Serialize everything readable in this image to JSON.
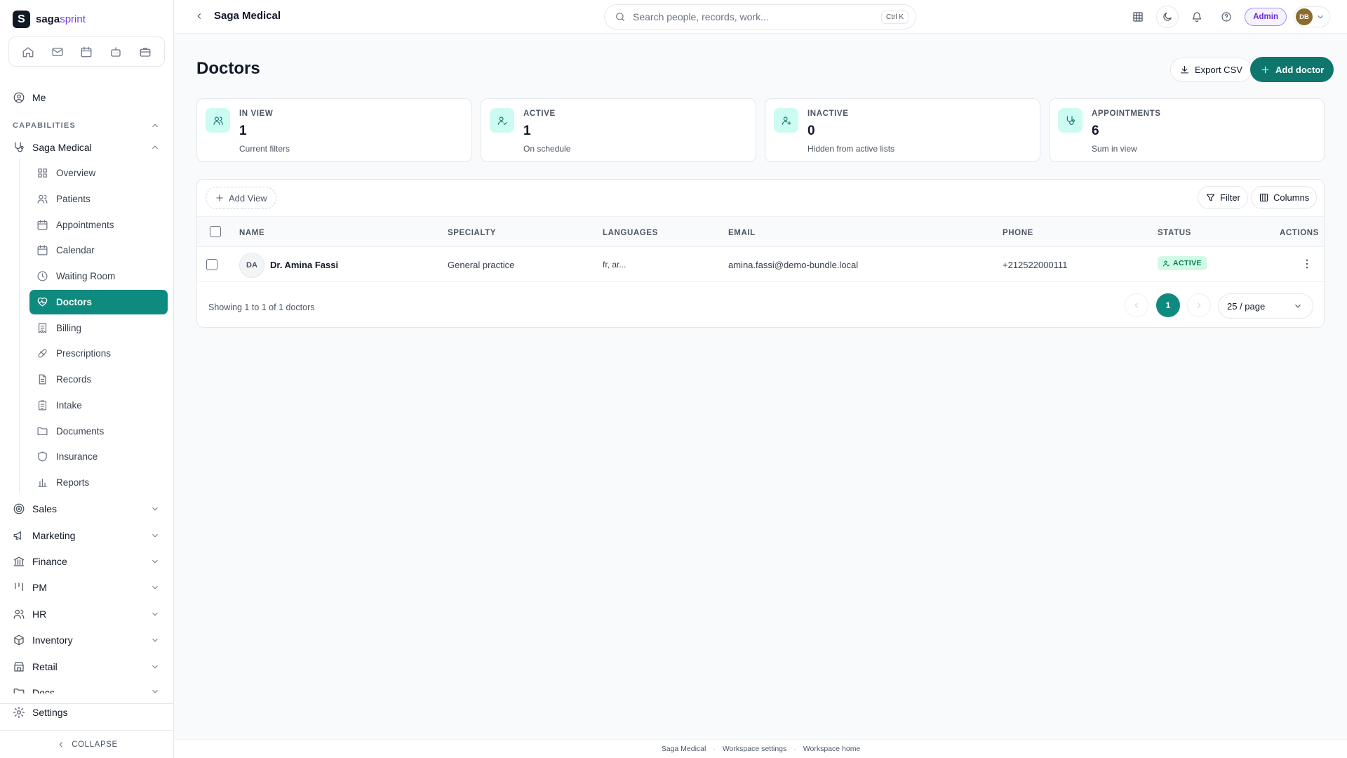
{
  "brand": {
    "name_part1": "saga",
    "name_part2": "sprint",
    "logo_letter": "S"
  },
  "quickbar": [
    "home-icon",
    "mail-icon",
    "calendar-icon",
    "bot-icon",
    "briefcase-icon"
  ],
  "sidebar": {
    "me": "Me",
    "capabilities_label": "CAPABILITIES",
    "active_group": "Saga Medical",
    "sub_items": [
      {
        "label": "Overview",
        "icon": "grid-icon"
      },
      {
        "label": "Patients",
        "icon": "users-icon"
      },
      {
        "label": "Appointments",
        "icon": "calendar-icon"
      },
      {
        "label": "Calendar",
        "icon": "calendar-icon"
      },
      {
        "label": "Waiting Room",
        "icon": "clock-icon"
      },
      {
        "label": "Doctors",
        "icon": "heart-pulse-icon"
      },
      {
        "label": "Billing",
        "icon": "receipt-icon"
      },
      {
        "label": "Prescriptions",
        "icon": "pill-icon"
      },
      {
        "label": "Records",
        "icon": "file-icon"
      },
      {
        "label": "Intake",
        "icon": "clipboard-icon"
      },
      {
        "label": "Documents",
        "icon": "folder-icon"
      },
      {
        "label": "Insurance",
        "icon": "shield-icon"
      },
      {
        "label": "Reports",
        "icon": "bar-chart-icon"
      }
    ],
    "groups": [
      "Sales",
      "Marketing",
      "Finance",
      "PM",
      "HR",
      "Inventory",
      "Retail",
      "Docs"
    ],
    "settings": "Settings",
    "collapse": "COLLAPSE"
  },
  "topbar": {
    "breadcrumb": "Saga Medical",
    "search_placeholder": "Search people, records, work...",
    "search_shortcut": "Ctrl K",
    "role_badge": "Admin",
    "avatar_initials": "DB"
  },
  "page": {
    "title": "Doctors",
    "export_label": "Export CSV",
    "add_label": "Add doctor"
  },
  "stats": [
    {
      "label": "IN VIEW",
      "value": "1",
      "sub": "Current filters",
      "icon": "users-icon"
    },
    {
      "label": "ACTIVE",
      "value": "1",
      "sub": "On schedule",
      "icon": "user-check-icon"
    },
    {
      "label": "INACTIVE",
      "value": "0",
      "sub": "Hidden from active lists",
      "icon": "user-plus-icon"
    },
    {
      "label": "APPOINTMENTS",
      "value": "6",
      "sub": "Sum in view",
      "icon": "stethoscope-icon"
    }
  ],
  "table": {
    "add_view": "Add View",
    "filter": "Filter",
    "columns_btn": "Columns",
    "columns": [
      "NAME",
      "SPECIALTY",
      "LANGUAGES",
      "EMAIL",
      "PHONE",
      "STATUS",
      "ACTIONS"
    ],
    "rows": [
      {
        "initials": "DA",
        "name": "Dr. Amina Fassi",
        "specialty": "General practice",
        "languages": "fr, ar...",
        "email": "amina.fassi@demo-bundle.local",
        "phone": "+212522000111",
        "status": "ACTIVE"
      }
    ],
    "showing": "Showing 1 to 1 of 1 doctors",
    "current_page": "1",
    "per_page": "25 / page"
  },
  "footer": [
    "Saga Medical",
    "Workspace settings",
    "Workspace home"
  ],
  "colors": {
    "accent": "#0f8a7e",
    "primary_button": "#0f766e",
    "admin": "#6d28d9"
  }
}
